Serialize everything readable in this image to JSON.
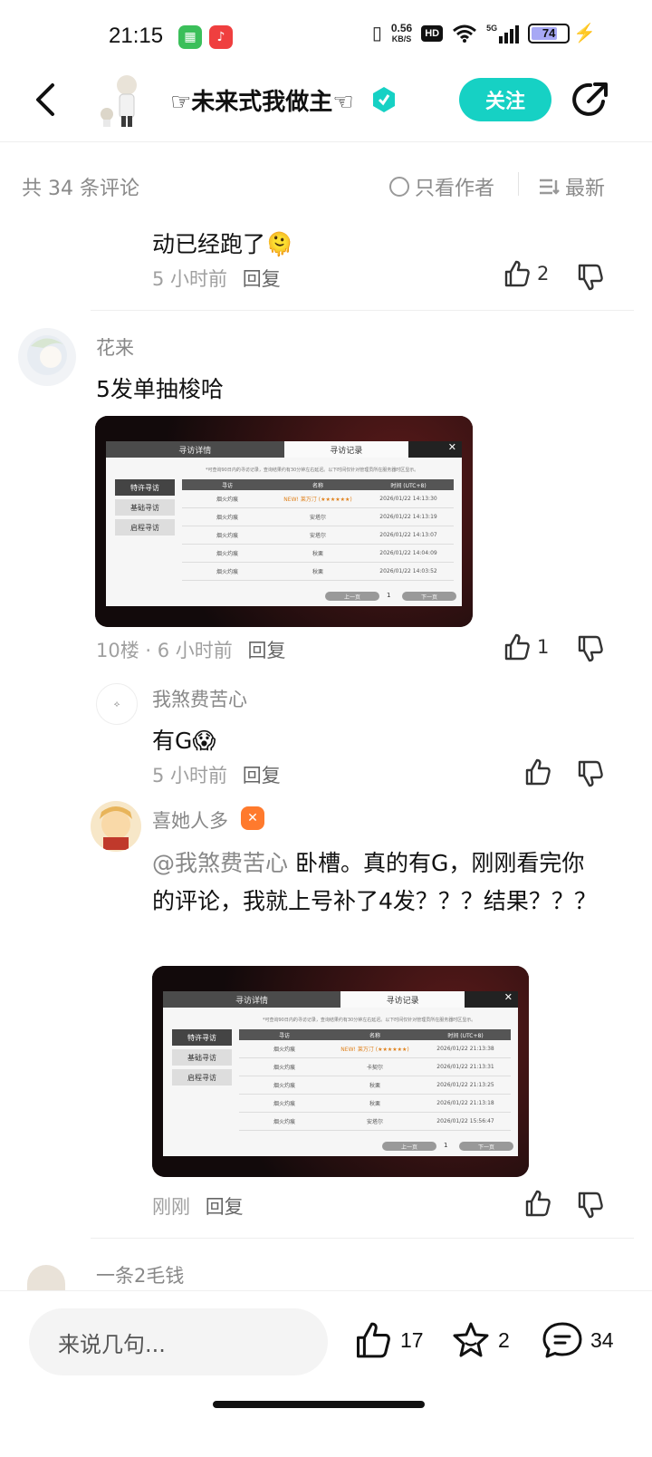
{
  "status_bar": {
    "time": "21:15",
    "net_speed_value": "0.56",
    "net_speed_unit": "KB/S",
    "hd": "HD",
    "signal_label": "5G",
    "battery": "74",
    "battery_level": 0.74
  },
  "header": {
    "title": "☞未来式我做主☜",
    "follow_label": "关注"
  },
  "toolbar": {
    "count": "共 34 条评论",
    "only_author": "只看作者",
    "sort": "最新"
  },
  "comments": [
    {
      "text": "动已经跑了🫠",
      "time": "5 小时前",
      "reply": "回复",
      "likes": "2"
    },
    {
      "name": "花来",
      "text": "5发单抽梭哈",
      "time": "10楼 · 6 小时前",
      "reply": "回复",
      "likes": "1",
      "screenshot": {
        "tab_left": "寻访详情",
        "tab_right": "寻访记录",
        "note": "*可查询90日内的寻访记录，查询结果约有30分钟左右延迟。以下时间仅针对管理员所在服务器时区显示。",
        "side": [
          "特许寻访",
          "基础寻访",
          "启程寻访"
        ],
        "headers": [
          "寻访",
          "名称",
          "时间 (UTC+8)"
        ],
        "rows": [
          [
            "烟火灼痕",
            "NEW! 莱万汀 (★★★★★★)",
            "2026/01/22 14:13:30"
          ],
          [
            "烟火灼痕",
            "安塔尔",
            "2026/01/22 14:13:19"
          ],
          [
            "烟火灼痕",
            "安塔尔",
            "2026/01/22 14:13:07"
          ],
          [
            "烟火灼痕",
            "秋栗",
            "2026/01/22 14:04:09"
          ],
          [
            "烟火灼痕",
            "秋栗",
            "2026/01/22 14:03:52"
          ]
        ],
        "prev": "上一页",
        "page": "1",
        "next": "下一页"
      }
    }
  ],
  "replies": [
    {
      "name": "我煞费苦心",
      "text": "有G😱",
      "time": "5 小时前",
      "reply": "回复"
    },
    {
      "name": "喜她人多",
      "mention": "@我煞费苦心",
      "text": " 卧槽。真的有G，刚刚看完你的评论，我就上号补了4发？？？结果？？？",
      "time": "刚刚",
      "reply": "回复",
      "screenshot": {
        "tab_left": "寻访详情",
        "tab_right": "寻访记录",
        "note": "*可查询90日内的寻访记录，查询结果约有30分钟左右延迟。以下时间仅针对管理员所在服务器时区显示。",
        "side": [
          "特许寻访",
          "基础寻访",
          "启程寻访"
        ],
        "headers": [
          "寻访",
          "名称",
          "时间 (UTC+8)"
        ],
        "rows": [
          [
            "烟火灼痕",
            "NEW! 莱万汀 (★★★★★★)",
            "2026/01/22 21:13:38"
          ],
          [
            "烟火灼痕",
            "卡契尔",
            "2026/01/22 21:13:31"
          ],
          [
            "烟火灼痕",
            "秋栗",
            "2026/01/22 21:13:25"
          ],
          [
            "烟火灼痕",
            "秋栗",
            "2026/01/22 21:13:18"
          ],
          [
            "烟火灼痕",
            "安塔尔",
            "2026/01/22 15:56:47"
          ]
        ],
        "prev": "上一页",
        "page": "1",
        "next": "下一页"
      }
    }
  ],
  "next_comment": {
    "name": "一条2毛钱"
  },
  "bottom_bar": {
    "placeholder": "来说几句...",
    "likes": "17",
    "favorites": "2",
    "comments": "34"
  },
  "colors": {
    "accent": "#16d1c4",
    "muted": "#8a8a8a"
  },
  "icons": [
    "back-icon",
    "share-icon",
    "thumb-up-icon",
    "thumb-down-icon",
    "star-icon",
    "comment-icon"
  ]
}
